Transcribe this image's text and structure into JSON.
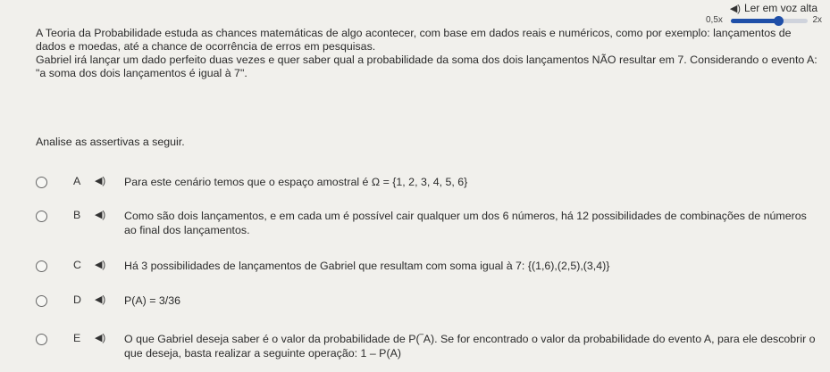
{
  "tts": {
    "read_aloud_label": "Ler em voz alta",
    "speed_min_label": "0,5x",
    "speed_max_label": "2x",
    "speed_level_fraction": 0.62
  },
  "question": {
    "paragraph1": "A Teoria da Probabilidade estuda as chances matemáticas de algo acontecer, com base em dados reais e numéricos, como por exemplo: lançamentos de dados e moedas, até a chance de ocorrência de erros em pesquisas.",
    "paragraph2": "Gabriel irá lançar um dado perfeito duas vezes e quer saber qual a probabilidade da soma dos dois lançamentos NÃO resultar em 7. Considerando o evento A: \"a soma dos dois lançamentos é igual à 7\".",
    "prompt": "Analise as assertivas a seguir."
  },
  "options": [
    {
      "letter": "A",
      "text": "Para este cenário temos que o espaço amostral é Ω = {1, 2, 3, 4, 5, 6}"
    },
    {
      "letter": "B",
      "text": "Como são dois lançamentos, e em cada um é possível cair qualquer um dos 6 números, há 12 possibilidades de combinações de números ao final dos lançamentos."
    },
    {
      "letter": "C",
      "text": "Há 3 possibilidades de lançamentos de Gabriel que resultam com soma igual à 7: {(1,6),(2,5),(3,4)}"
    },
    {
      "letter": "D",
      "text": "P(A) = 3/36"
    },
    {
      "letter": "E",
      "text": "O que Gabriel deseja saber é o valor da probabilidade de P(‾A). Se for encontrado o valor da probabilidade do evento A, para ele descobrir o que deseja, basta realizar a seguinte operação: 1 – P(A)"
    }
  ]
}
